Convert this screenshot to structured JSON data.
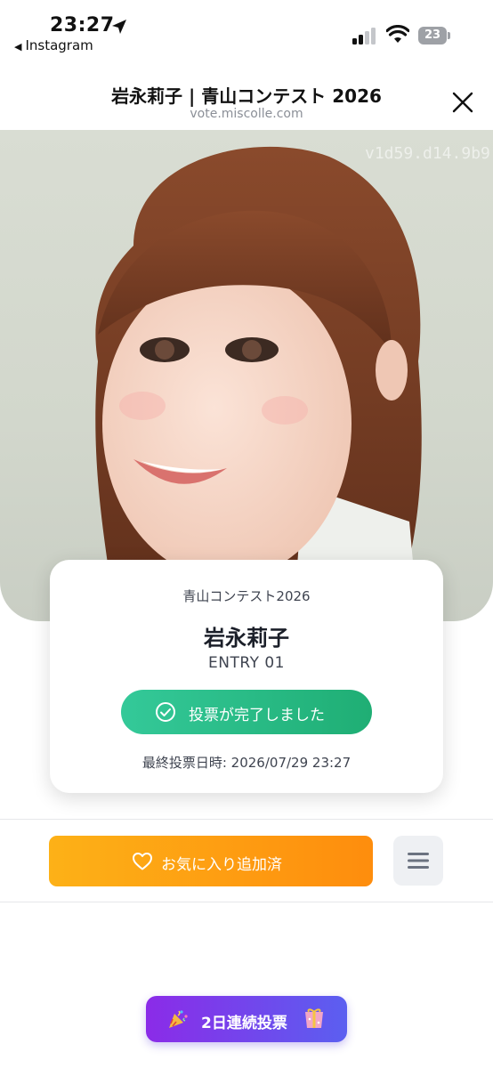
{
  "status_bar": {
    "time": "23:27",
    "back_app": "Instagram",
    "battery": "23"
  },
  "browser": {
    "title": "岩永莉子 | 青山コンテスト 2026",
    "url": "vote.miscolle.com"
  },
  "hero": {
    "watermark": "v1d59.d14.9b9"
  },
  "entry_card": {
    "contest": "青山コンテスト2026",
    "name": "岩永莉子",
    "entry": "ENTRY 01",
    "vote_status": "投票が完了しました",
    "last_vote": "最終投票日時: 2026/07/29 23:27"
  },
  "actions": {
    "favorite_label": "お気に入り追加済"
  },
  "streak": {
    "label": "2日連続投票"
  },
  "colors": {
    "vote_green": "#22b07d",
    "favorite_orange": "#fe9a10",
    "streak_purple": "#7a3cec"
  }
}
